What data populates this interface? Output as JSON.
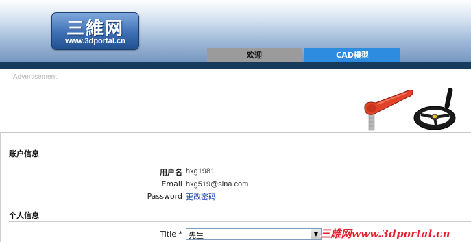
{
  "header": {
    "logo": {
      "title": "三維网",
      "subtitle": "www.3dportal.cn"
    },
    "tabs": [
      {
        "label": "欢迎",
        "active": false,
        "color": "#9b9b9b"
      },
      {
        "label": "CAD模型",
        "active": true,
        "color": "#2d8be0"
      }
    ]
  },
  "advertisement": {
    "label": "Advertisement:",
    "image_icon": "adjustable-lever-and-handwheel"
  },
  "account_section": {
    "title": "账户信息",
    "fields": [
      {
        "label": "用户名",
        "value": "hxg1981"
      },
      {
        "label": "Email",
        "value": "hxg519@sina.com"
      },
      {
        "label": "Password",
        "link_text": "更改密码"
      }
    ]
  },
  "personal_section": {
    "title": "个人信息",
    "title_field": {
      "label": "Title *",
      "selected": "先生"
    }
  },
  "watermark": "三維网www.3dportal.cn",
  "colors": {
    "accent": "#2d8be0",
    "header_dark": "#173a5d",
    "watermark": "#e4202c"
  }
}
